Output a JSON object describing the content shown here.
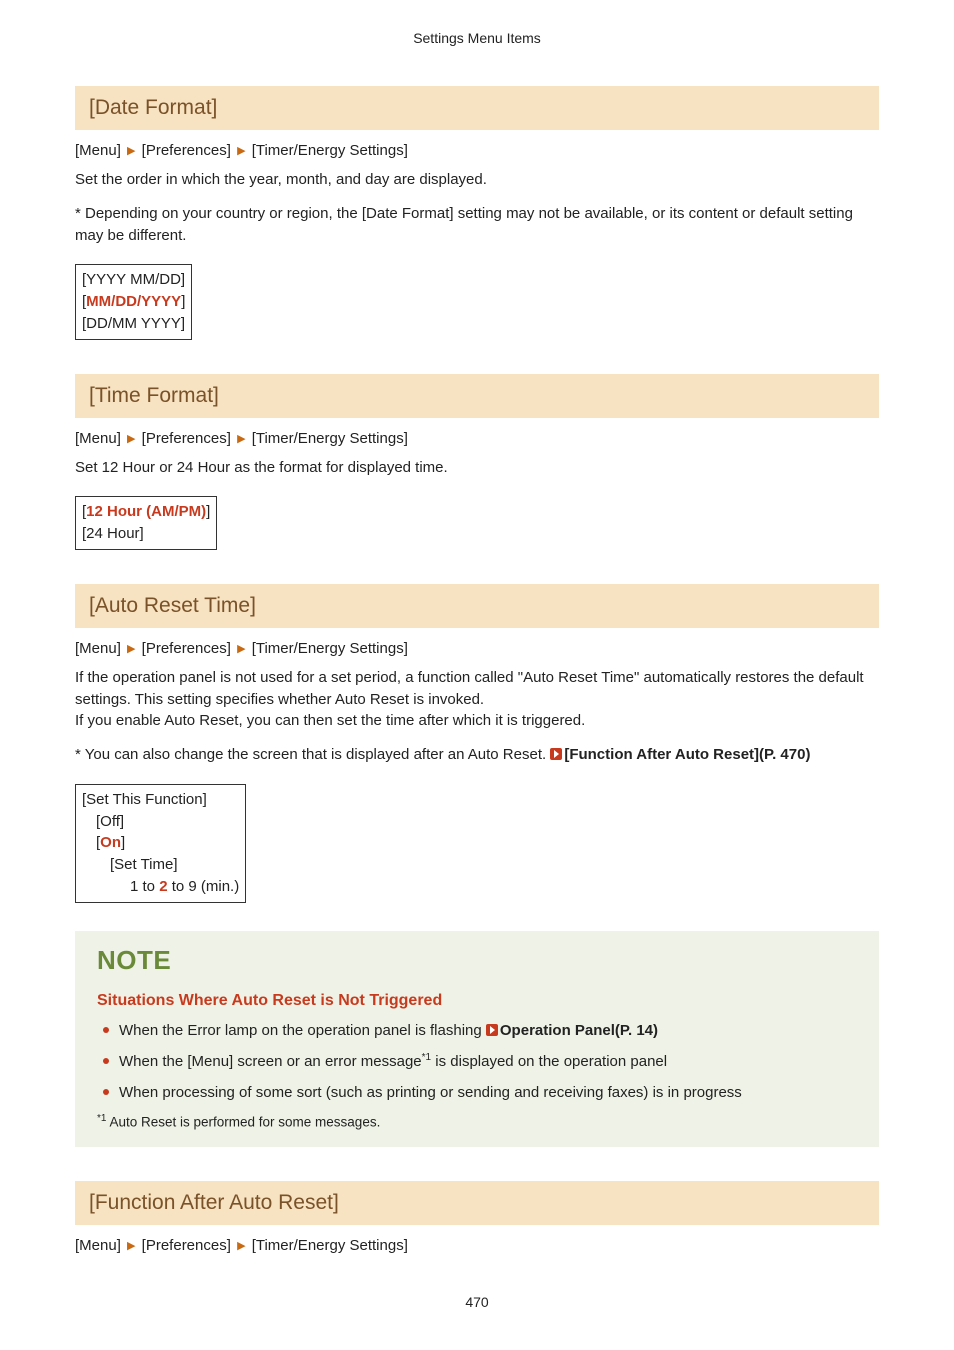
{
  "header": {
    "title": "Settings Menu Items"
  },
  "breadcrumb": {
    "menu": "[Menu]",
    "prefs": "[Preferences]",
    "timer": "[Timer/Energy Settings]"
  },
  "dateFormat": {
    "heading": "[Date Format]",
    "p1": "Set the order in which the year, month, and day are displayed.",
    "p2": "* Depending on your country or region, the [Date Format] setting may not be available, or its content or default setting may be different.",
    "opt1": "[YYYY MM/DD]",
    "opt2_open": "[",
    "opt2_val": "MM/DD/YYYY",
    "opt2_close": "]",
    "opt3": "[DD/MM YYYY]"
  },
  "timeFormat": {
    "heading": "[Time Format]",
    "p1": "Set 12 Hour or 24 Hour as the format for displayed time.",
    "opt1_open": "[",
    "opt1_val": "12 Hour (AM/PM)",
    "opt1_close": "]",
    "opt2": "[24 Hour]"
  },
  "autoReset": {
    "heading": "[Auto Reset Time]",
    "p1": "If the operation panel is not used for a set period, a function called \"Auto Reset Time\" automatically restores the default settings. This setting specifies whether Auto Reset is invoked.",
    "p2": "If you enable Auto Reset, you can then set the time after which it is triggered.",
    "p3_pre": "* You can also change the screen that is displayed after an Auto Reset. ",
    "p3_link": "[Function After Auto Reset](P. 470)",
    "box_l1": "[Set This Function]",
    "box_l2": "[Off]",
    "box_l3_open": "[",
    "box_l3_val": "On",
    "box_l3_close": "]",
    "box_l4": "[Set Time]",
    "box_l5_a": "1 to ",
    "box_l5_b": "2",
    "box_l5_c": " to 9 (min.)"
  },
  "note": {
    "title": "NOTE",
    "subtitle": "Situations Where Auto Reset is Not Triggered",
    "b1_pre": "When the Error lamp on the operation panel is flashing ",
    "b1_link": "Operation Panel(P. 14)",
    "b2_pre": "When the [Menu] screen or an error message",
    "b2_sup": "*1",
    "b2_post": " is displayed on the operation panel",
    "b3": "When processing of some sort (such as printing or sending and receiving faxes) is in progress",
    "fn_sup": "*1",
    "fn_text": " Auto Reset is performed for some messages."
  },
  "funcAfter": {
    "heading": "[Function After Auto Reset]"
  },
  "pageNumber": "470"
}
